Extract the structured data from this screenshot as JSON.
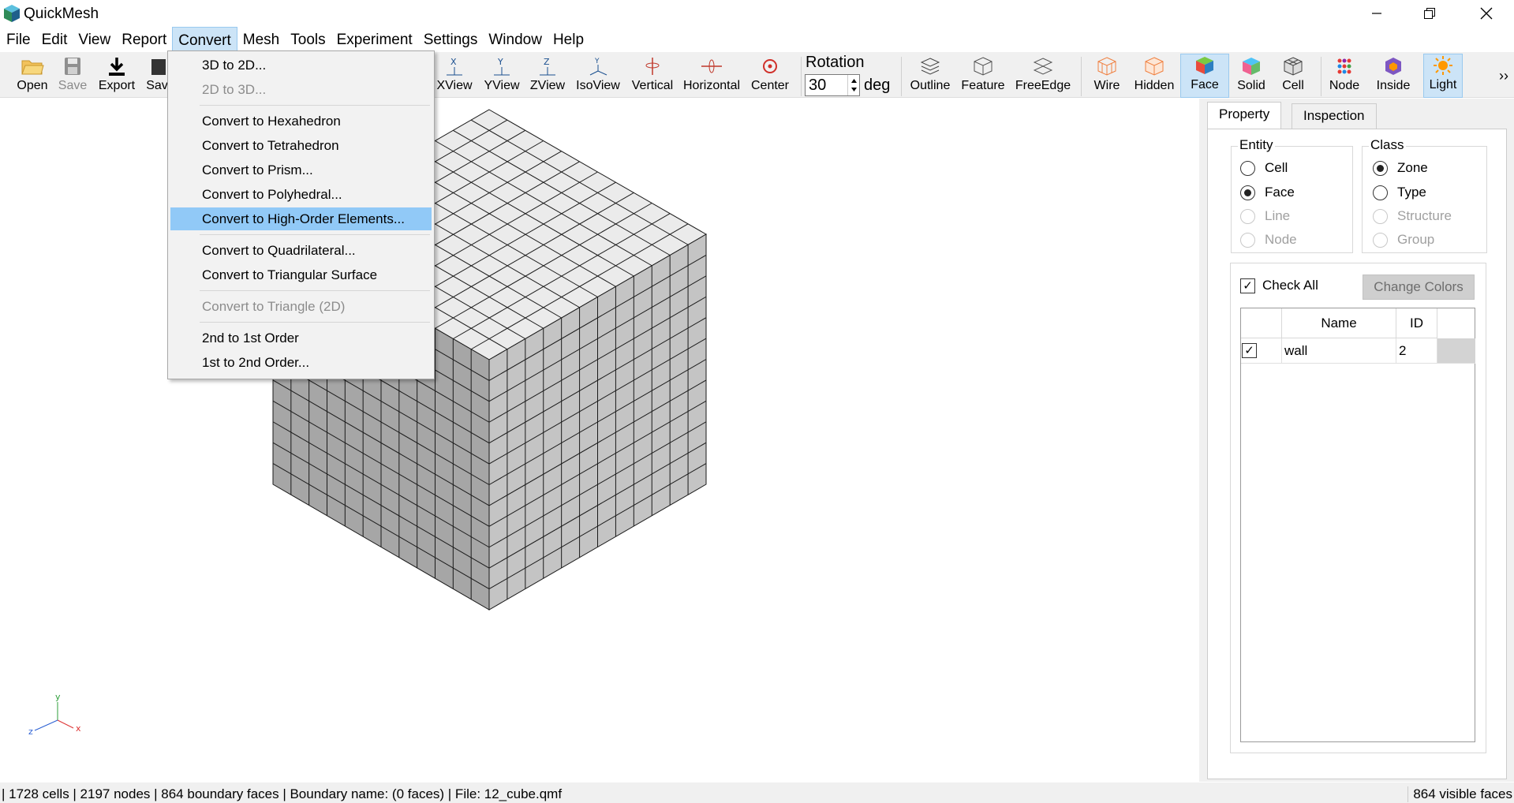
{
  "app": {
    "title": "QuickMesh"
  },
  "menu": [
    "File",
    "Edit",
    "View",
    "Report",
    "Convert",
    "Mesh",
    "Tools",
    "Experiment",
    "Settings",
    "Window",
    "Help"
  ],
  "active_menu": "Convert",
  "toolbar": {
    "open": "Open",
    "save": "Save",
    "export": "Export",
    "save2": "Sav",
    "xview": "XView",
    "yview": "YView",
    "zview": "ZView",
    "isoview": "IsoView",
    "vertical": "Vertical",
    "horizontal": "Horizontal",
    "center": "Center",
    "rotation_label": "Rotation",
    "rotation_value": "30",
    "rotation_unit": "deg",
    "outline": "Outline",
    "feature": "Feature",
    "freeedge": "FreeEdge",
    "wire": "Wire",
    "hidden": "Hidden",
    "face": "Face",
    "solid": "Solid",
    "cell": "Cell",
    "node": "Node",
    "inside": "Inside",
    "light": "Light",
    "overflow": "››"
  },
  "convert_menu": {
    "items": [
      {
        "label": "3D to 2D...",
        "enabled": true
      },
      {
        "label": "2D to 3D...",
        "enabled": false
      },
      {
        "label": "Convert to Hexahedron",
        "enabled": true
      },
      {
        "label": "Convert to Tetrahedron",
        "enabled": true
      },
      {
        "label": "Convert to Prism...",
        "enabled": true
      },
      {
        "label": "Convert to Polyhedral...",
        "enabled": true
      },
      {
        "label": "Convert to High-Order Elements...",
        "enabled": true,
        "highlighted": true
      },
      {
        "label": "Convert to Quadrilateral...",
        "enabled": true
      },
      {
        "label": "Convert to Triangular Surface",
        "enabled": true
      },
      {
        "label": "Convert to Triangle (2D)",
        "enabled": false
      },
      {
        "label": "2nd to 1st Order",
        "enabled": true
      },
      {
        "label": "1st to 2nd Order...",
        "enabled": true
      }
    ]
  },
  "viewport": {
    "cube_divisions": 12,
    "axes": {
      "x": "x",
      "y": "y",
      "z": "z"
    },
    "colors": {
      "top": "#ebebeb",
      "right": "#c4c4c4",
      "left": "#a6a6a6",
      "edges": "#1a1a1a"
    }
  },
  "panel": {
    "tabs": [
      "Property",
      "Inspection"
    ],
    "active_tab": "Property",
    "entity": {
      "title": "Entity",
      "options": [
        "Cell",
        "Face",
        "Line",
        "Node"
      ],
      "selected": "Face",
      "disabled": [
        "Line",
        "Node"
      ]
    },
    "class": {
      "title": "Class",
      "options": [
        "Zone",
        "Type",
        "Structure",
        "Group"
      ],
      "selected": "Zone",
      "disabled": [
        "Structure",
        "Group"
      ]
    },
    "check_all": "Check All",
    "check_all_checked": true,
    "change_colors": "Change Colors",
    "table": {
      "headers": [
        "Name",
        "ID"
      ],
      "rows": [
        {
          "checked": true,
          "name": "wall",
          "id": "2",
          "color": "#d3d3d3"
        }
      ]
    }
  },
  "status": {
    "left": "| 1728 cells | 2197 nodes | 864 boundary faces |  Boundary name:  (0 faces) | File: 12_cube.qmf",
    "right": "864 visible faces"
  }
}
